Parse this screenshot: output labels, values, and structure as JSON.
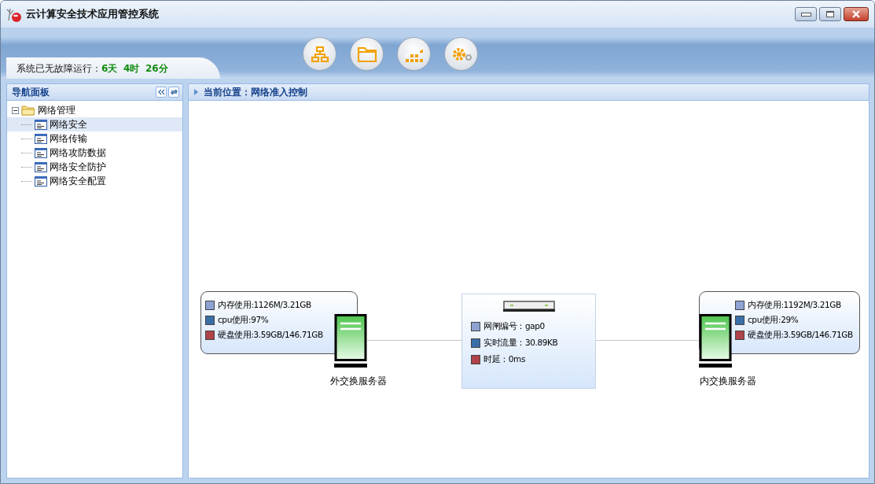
{
  "window": {
    "title": "云计算安全技术应用管控系统"
  },
  "uptime": {
    "label": "系统已无故障运行：",
    "days": "6天",
    "hours": "4时",
    "minutes": "26分"
  },
  "nav": {
    "title": "导航面板",
    "tree": [
      {
        "label": "网络管理",
        "expanded": true,
        "children": [
          {
            "label": "网络安全",
            "selected": true
          },
          {
            "label": "网络传输",
            "selected": false
          },
          {
            "label": "网络攻防数据",
            "selected": false
          },
          {
            "label": "网络安全防护",
            "selected": false
          },
          {
            "label": "网络安全配置",
            "selected": false
          }
        ]
      }
    ]
  },
  "breadcrumb": "当前位置：网络准入控制",
  "topology": {
    "servers": [
      {
        "name": "外交换服务器",
        "stats": [
          {
            "text": "内存使用:1126M/3.21GB",
            "color": "#8ea3d3"
          },
          {
            "text": "cpu使用:97%",
            "color": "#3a6fa8"
          },
          {
            "text": "硬盘使用:3.59GB/146.71GB",
            "color": "#b0424a"
          }
        ]
      },
      {
        "name": "内交换服务器",
        "stats": [
          {
            "text": "内存使用:1192M/3.21GB",
            "color": "#8ea3d3"
          },
          {
            "text": "cpu使用:29%",
            "color": "#3a6fa8"
          },
          {
            "text": "硬盘使用:3.59GB/146.71GB",
            "color": "#b0424a"
          }
        ]
      }
    ],
    "gateway": {
      "stats": [
        {
          "text": "网闸编号：gap0",
          "color": "#8ea3d3"
        },
        {
          "text": "实时流量：30.89KB",
          "color": "#3a6fa8"
        },
        {
          "text": "时延：0ms",
          "color": "#b0424a"
        }
      ]
    }
  }
}
